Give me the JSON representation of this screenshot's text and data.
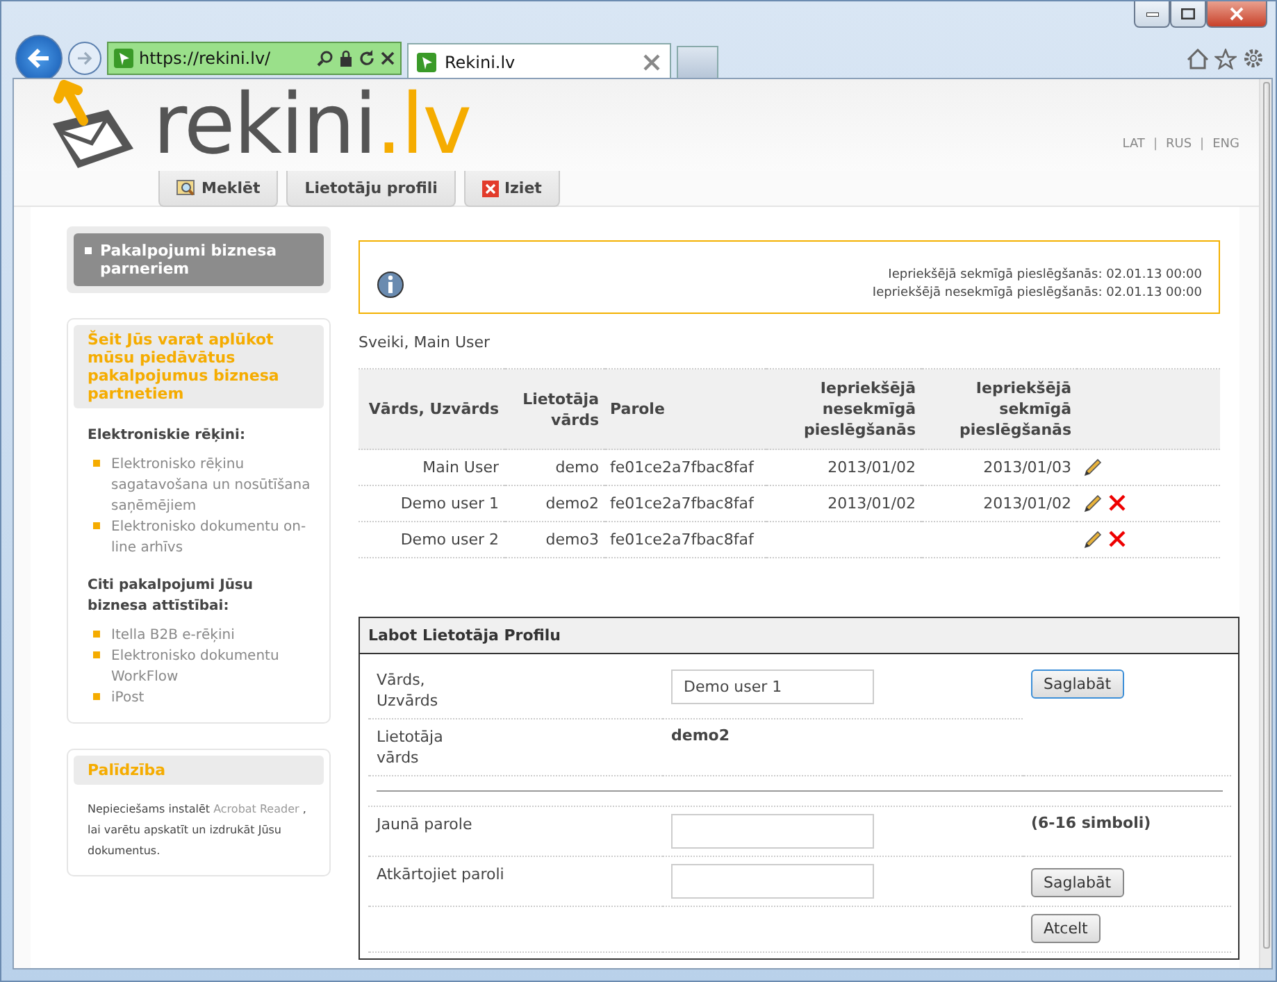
{
  "browser": {
    "address": "https://rekini.lv/",
    "tab_title": "Rekini.lv"
  },
  "logo": {
    "word": "rekini",
    "suffix": ".lv"
  },
  "languages": [
    "LAT",
    "RUS",
    "ENG"
  ],
  "language_separator": "|",
  "nav_tabs": [
    {
      "label": "Meklēt",
      "kind": "search"
    },
    {
      "label": "Lietotāju profili",
      "kind": "plain"
    },
    {
      "label": "Iziet",
      "kind": "exit"
    }
  ],
  "sidebar": {
    "menu_item": "Pakalpojumi biznesa parneriem",
    "promo": {
      "title": "Šeit Jūs varat aplūkot mūsu piedāvātus pakalpojumus biznesa partnetiem",
      "sections": [
        {
          "heading": "Elektroniskie rēķini:",
          "links": [
            "Elektronisko rēķinu sagatavošana un nosūtīšana saņēmējiem",
            "Elektronisko dokumentu on-line arhīvs"
          ]
        },
        {
          "heading": "Citi pakalpojumi Jūsu biznesa attīstībai:",
          "links": [
            "Itella B2B e-rēķini",
            "Elektronisko dokumentu WorkFlow",
            "iPost"
          ]
        }
      ]
    },
    "help": {
      "title": "Palīdzība",
      "text_before": "Nepieciešams instalēt",
      "link": "Acrobat Reader",
      "text_after": ", lai varētu apskatīt un izdrukāt Jūsu dokumentus."
    }
  },
  "info_box": {
    "lines": [
      "Iepriekšējā sekmīgā pieslēgšanās: 02.01.13 00:00",
      "Iepriekšējā nesekmīgā pieslēgšanās: 02.01.13 00:00"
    ]
  },
  "greeting": "Sveiki, Main User",
  "users_table": {
    "columns": [
      "Vārds, Uzvārds",
      "Lietotāja vārds",
      "Parole",
      "Iepriekšējā nesekmīgā pieslēgšanās",
      "Iepriekšējā sekmīgā pieslēgšanās"
    ],
    "rows": [
      {
        "cells": [
          "Main User",
          "demo",
          "fe01ce2a7fbac8faf",
          "2013/01/02",
          "2013/01/03"
        ],
        "deletable": false
      },
      {
        "cells": [
          "Demo user 1",
          "demo2",
          "fe01ce2a7fbac8faf",
          "2013/01/02",
          "2013/01/02"
        ],
        "deletable": true
      },
      {
        "cells": [
          "Demo user 2",
          "demo3",
          "fe01ce2a7fbac8faf",
          "",
          ""
        ],
        "deletable": true
      }
    ]
  },
  "edit_form": {
    "title": "Labot Lietotāja Profilu",
    "name_label": "Vārds, Uzvārds",
    "name_value": "Demo user 1",
    "save_button": "Saglabāt",
    "username_label": "Lietotāja vārds",
    "username_value": "demo2",
    "new_password_label": "Jaunā parole",
    "password_hint": "(6-16 simboli)",
    "repeat_password_label": "Atkārtojiet paroli",
    "save_password_button": "Saglabāt",
    "cancel_button": "Atcelt"
  }
}
